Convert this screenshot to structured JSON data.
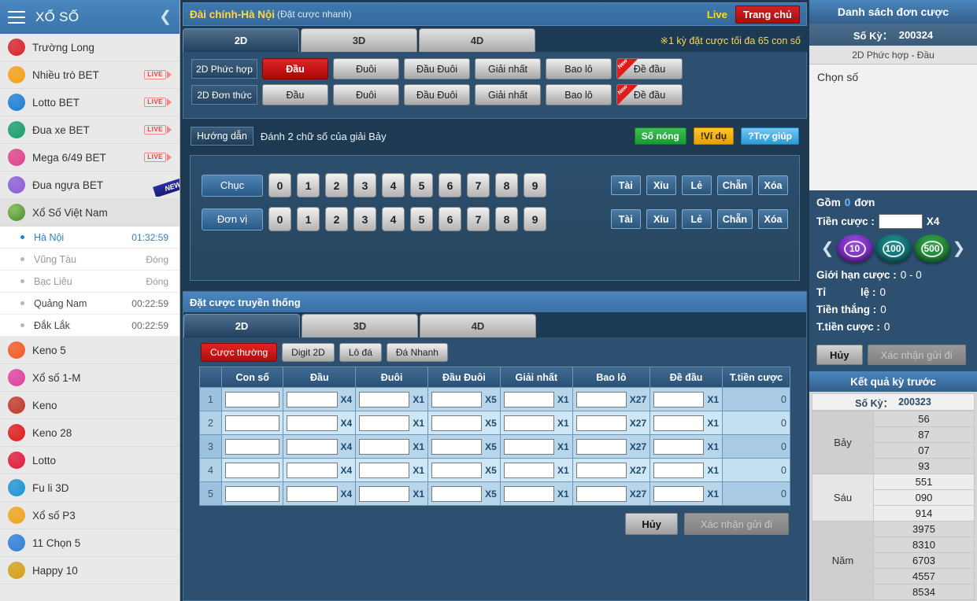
{
  "sidebar": {
    "header": {
      "title": "XỔ SỐ",
      "menu_icon": "hamburger-icon",
      "collapse_icon": "chevron-left-icon"
    },
    "items": [
      {
        "label": "Trường Long",
        "icon": "trend-up-icon",
        "color": "#d8232a",
        "badge": "",
        "new": false
      },
      {
        "label": "Nhiều trò BET",
        "icon": "bet-multi-icon",
        "color": "#f5a017",
        "badge": "LIVE",
        "new": false
      },
      {
        "label": "Lotto BET",
        "icon": "bet-lotto-icon",
        "color": "#1a7fd4",
        "badge": "LIVE",
        "new": false
      },
      {
        "label": "Đua xe BET",
        "icon": "bet-race-icon",
        "color": "#16a06a",
        "badge": "LIVE",
        "new": false
      },
      {
        "label": "Mega 6/49 BET",
        "icon": "bet-mega-icon",
        "color": "#e0418c",
        "badge": "LIVE",
        "new": false
      },
      {
        "label": "Đua ngựa BET",
        "icon": "bet-horse-icon",
        "color": "#8b5cd6",
        "badge": "",
        "new": true,
        "new_label": "NEW"
      }
    ],
    "group": {
      "label": "Xổ Số Việt Nam",
      "icon": "lottery-balls-icon",
      "color": "#6aa84f"
    },
    "draws": [
      {
        "name": "Hà Nội",
        "time": "01:32:59",
        "state": "active"
      },
      {
        "name": "Vũng Tàu",
        "time": "Đóng",
        "state": "closed"
      },
      {
        "name": "Bạc Liêu",
        "time": "Đóng",
        "state": "closed"
      },
      {
        "name": "Quảng Nam",
        "time": "00:22:59",
        "state": "open"
      },
      {
        "name": "Đắk Lắk",
        "time": "00:22:59",
        "state": "open"
      }
    ],
    "items2": [
      {
        "label": "Keno 5",
        "icon": "keno5-icon",
        "color": "#f05a22"
      },
      {
        "label": "Xổ số 1-M",
        "icon": "xoso1m-icon",
        "color": "#e040a0"
      },
      {
        "label": "Keno",
        "icon": "keno-icon",
        "color": "#c0392b"
      },
      {
        "label": "Keno 28",
        "icon": "keno28-icon",
        "color": "#e01b1b"
      },
      {
        "label": "Lotto",
        "icon": "lotto-icon",
        "color": "#e01b3b"
      },
      {
        "label": "Fu li 3D",
        "icon": "fuli3d-icon",
        "color": "#1b94d4"
      },
      {
        "label": "Xổ số P3",
        "icon": "xosop3-icon",
        "color": "#f0a51b"
      },
      {
        "label": "11 Chọn 5",
        "icon": "chon5-icon",
        "color": "#2f7ed8"
      },
      {
        "label": "Happy 10",
        "icon": "happy10-icon",
        "color": "#d4a017"
      }
    ]
  },
  "header": {
    "title": "Đài chính-Hà Nội",
    "subtitle": "(Đặt cược nhanh)",
    "live_label": "Live",
    "home_label": "Trang chủ"
  },
  "main_tabs": [
    {
      "label": "2D",
      "active": true
    },
    {
      "label": "3D",
      "active": false
    },
    {
      "label": "4D",
      "active": false
    }
  ],
  "tab_note": "※1 kỳ đặt cược tối đa 65 con số",
  "bet_rows": [
    {
      "label": "2D Phức hợp",
      "buttons": [
        {
          "label": "Đầu",
          "active": true,
          "new": false
        },
        {
          "label": "Đuôi",
          "active": false,
          "new": false
        },
        {
          "label": "Đầu Đuôi",
          "active": false,
          "new": false
        },
        {
          "label": "Giải nhất",
          "active": false,
          "new": false
        },
        {
          "label": "Bao lô",
          "active": false,
          "new": false
        },
        {
          "label": "Đề đầu",
          "active": false,
          "new": true,
          "new_label": "New"
        }
      ]
    },
    {
      "label": "2D Đơn thức",
      "buttons": [
        {
          "label": "Đầu",
          "active": false,
          "new": false
        },
        {
          "label": "Đuôi",
          "active": false,
          "new": false
        },
        {
          "label": "Đầu Đuôi",
          "active": false,
          "new": false
        },
        {
          "label": "Giải nhất",
          "active": false,
          "new": false
        },
        {
          "label": "Bao lô",
          "active": false,
          "new": false
        },
        {
          "label": "Đề đầu",
          "active": false,
          "new": true,
          "new_label": "New"
        }
      ]
    }
  ],
  "guide": {
    "label": "Hướng dẫn",
    "text": "Đánh 2 chữ số của giải Bảy",
    "hot_label": "Số nóng",
    "example_label": "Ví dụ",
    "help_label": "Trợ giúp",
    "example_icon": "exclamation-icon",
    "help_icon": "question-icon"
  },
  "number_panel": {
    "rows": [
      {
        "label": "Chục",
        "digits": [
          "0",
          "1",
          "2",
          "3",
          "4",
          "5",
          "6",
          "7",
          "8",
          "9"
        ],
        "ops": [
          "Tài",
          "Xỉu",
          "Lẻ",
          "Chẵn",
          "Xóa"
        ]
      },
      {
        "label": "Đơn vị",
        "digits": [
          "0",
          "1",
          "2",
          "3",
          "4",
          "5",
          "6",
          "7",
          "8",
          "9"
        ],
        "ops": [
          "Tài",
          "Xỉu",
          "Lẻ",
          "Chẵn",
          "Xóa"
        ]
      }
    ]
  },
  "traditional": {
    "title": "Đặt cược truyền thống",
    "tabs": [
      {
        "label": "2D",
        "active": true
      },
      {
        "label": "3D",
        "active": false
      },
      {
        "label": "4D",
        "active": false
      }
    ],
    "mini_tabs": [
      {
        "label": "Cược thường",
        "active": true
      },
      {
        "label": "Digit 2D",
        "active": false
      },
      {
        "label": "Lô đá",
        "active": false
      },
      {
        "label": "Đá Nhanh",
        "active": false
      }
    ],
    "columns": [
      "",
      "Con số",
      "Đầu",
      "Đuôi",
      "Đầu Đuôi",
      "Giải nhất",
      "Bao lô",
      "Đề đầu",
      "T.tiền cược"
    ],
    "multipliers": [
      "X4",
      "X1",
      "X5",
      "X1",
      "X27",
      "X1"
    ],
    "rows": [
      {
        "index": "1",
        "number": "",
        "values": [
          "",
          "",
          "",
          "",
          "",
          ""
        ],
        "total": "0"
      },
      {
        "index": "2",
        "number": "",
        "values": [
          "",
          "",
          "",
          "",
          "",
          ""
        ],
        "total": "0"
      },
      {
        "index": "3",
        "number": "",
        "values": [
          "",
          "",
          "",
          "",
          "",
          ""
        ],
        "total": "0"
      },
      {
        "index": "4",
        "number": "",
        "values": [
          "",
          "",
          "",
          "",
          "",
          ""
        ],
        "total": "0"
      },
      {
        "index": "5",
        "number": "",
        "values": [
          "",
          "",
          "",
          "",
          "",
          ""
        ],
        "total": "0"
      }
    ],
    "cancel_label": "Hủy",
    "confirm_label": "Xác nhận gửi đi"
  },
  "right": {
    "title": "Danh sách đơn cược",
    "period_label": "Số Kỳ：",
    "period_value": "200324",
    "bet_kind": "2D Phức hợp - Đầu",
    "empty_text": "Chọn số",
    "count_prefix": "Gồm",
    "count_value": "0",
    "count_suffix": "đơn",
    "amount_label": "Tiền cược :",
    "amount_value": "",
    "amount_mult": "X4",
    "chips": [
      {
        "value": "10",
        "color": "#7a2fc4"
      },
      {
        "value": "100",
        "color": "#117070"
      },
      {
        "value": "500",
        "color": "#1d7a34"
      }
    ],
    "prev_icon": "chevron-left-icon",
    "next_icon": "chevron-right-icon",
    "limit_label": "Giới hạn cược :",
    "limit_value": "0 - 0",
    "ratio_label_a": "Tỉ",
    "ratio_label_b": "lệ :",
    "ratio_value": "0",
    "win_label": "Tiền thắng :",
    "win_value": "0",
    "total_label": "T.tiền cược :",
    "total_value": "0",
    "cancel_label": "Hủy",
    "confirm_label": "Xác nhận gửi đi"
  },
  "results": {
    "title": "Kết quả kỳ trước",
    "period_label": "Số Kỳ：",
    "period_value": "200323",
    "groups": [
      {
        "label": "Bảy",
        "values": [
          "56",
          "87",
          "07",
          "93"
        ]
      },
      {
        "label": "Sáu",
        "values": [
          "551",
          "090",
          "914"
        ]
      },
      {
        "label": "Năm",
        "values": [
          "3975",
          "8310",
          "6703",
          "4557",
          "8534"
        ]
      }
    ]
  }
}
